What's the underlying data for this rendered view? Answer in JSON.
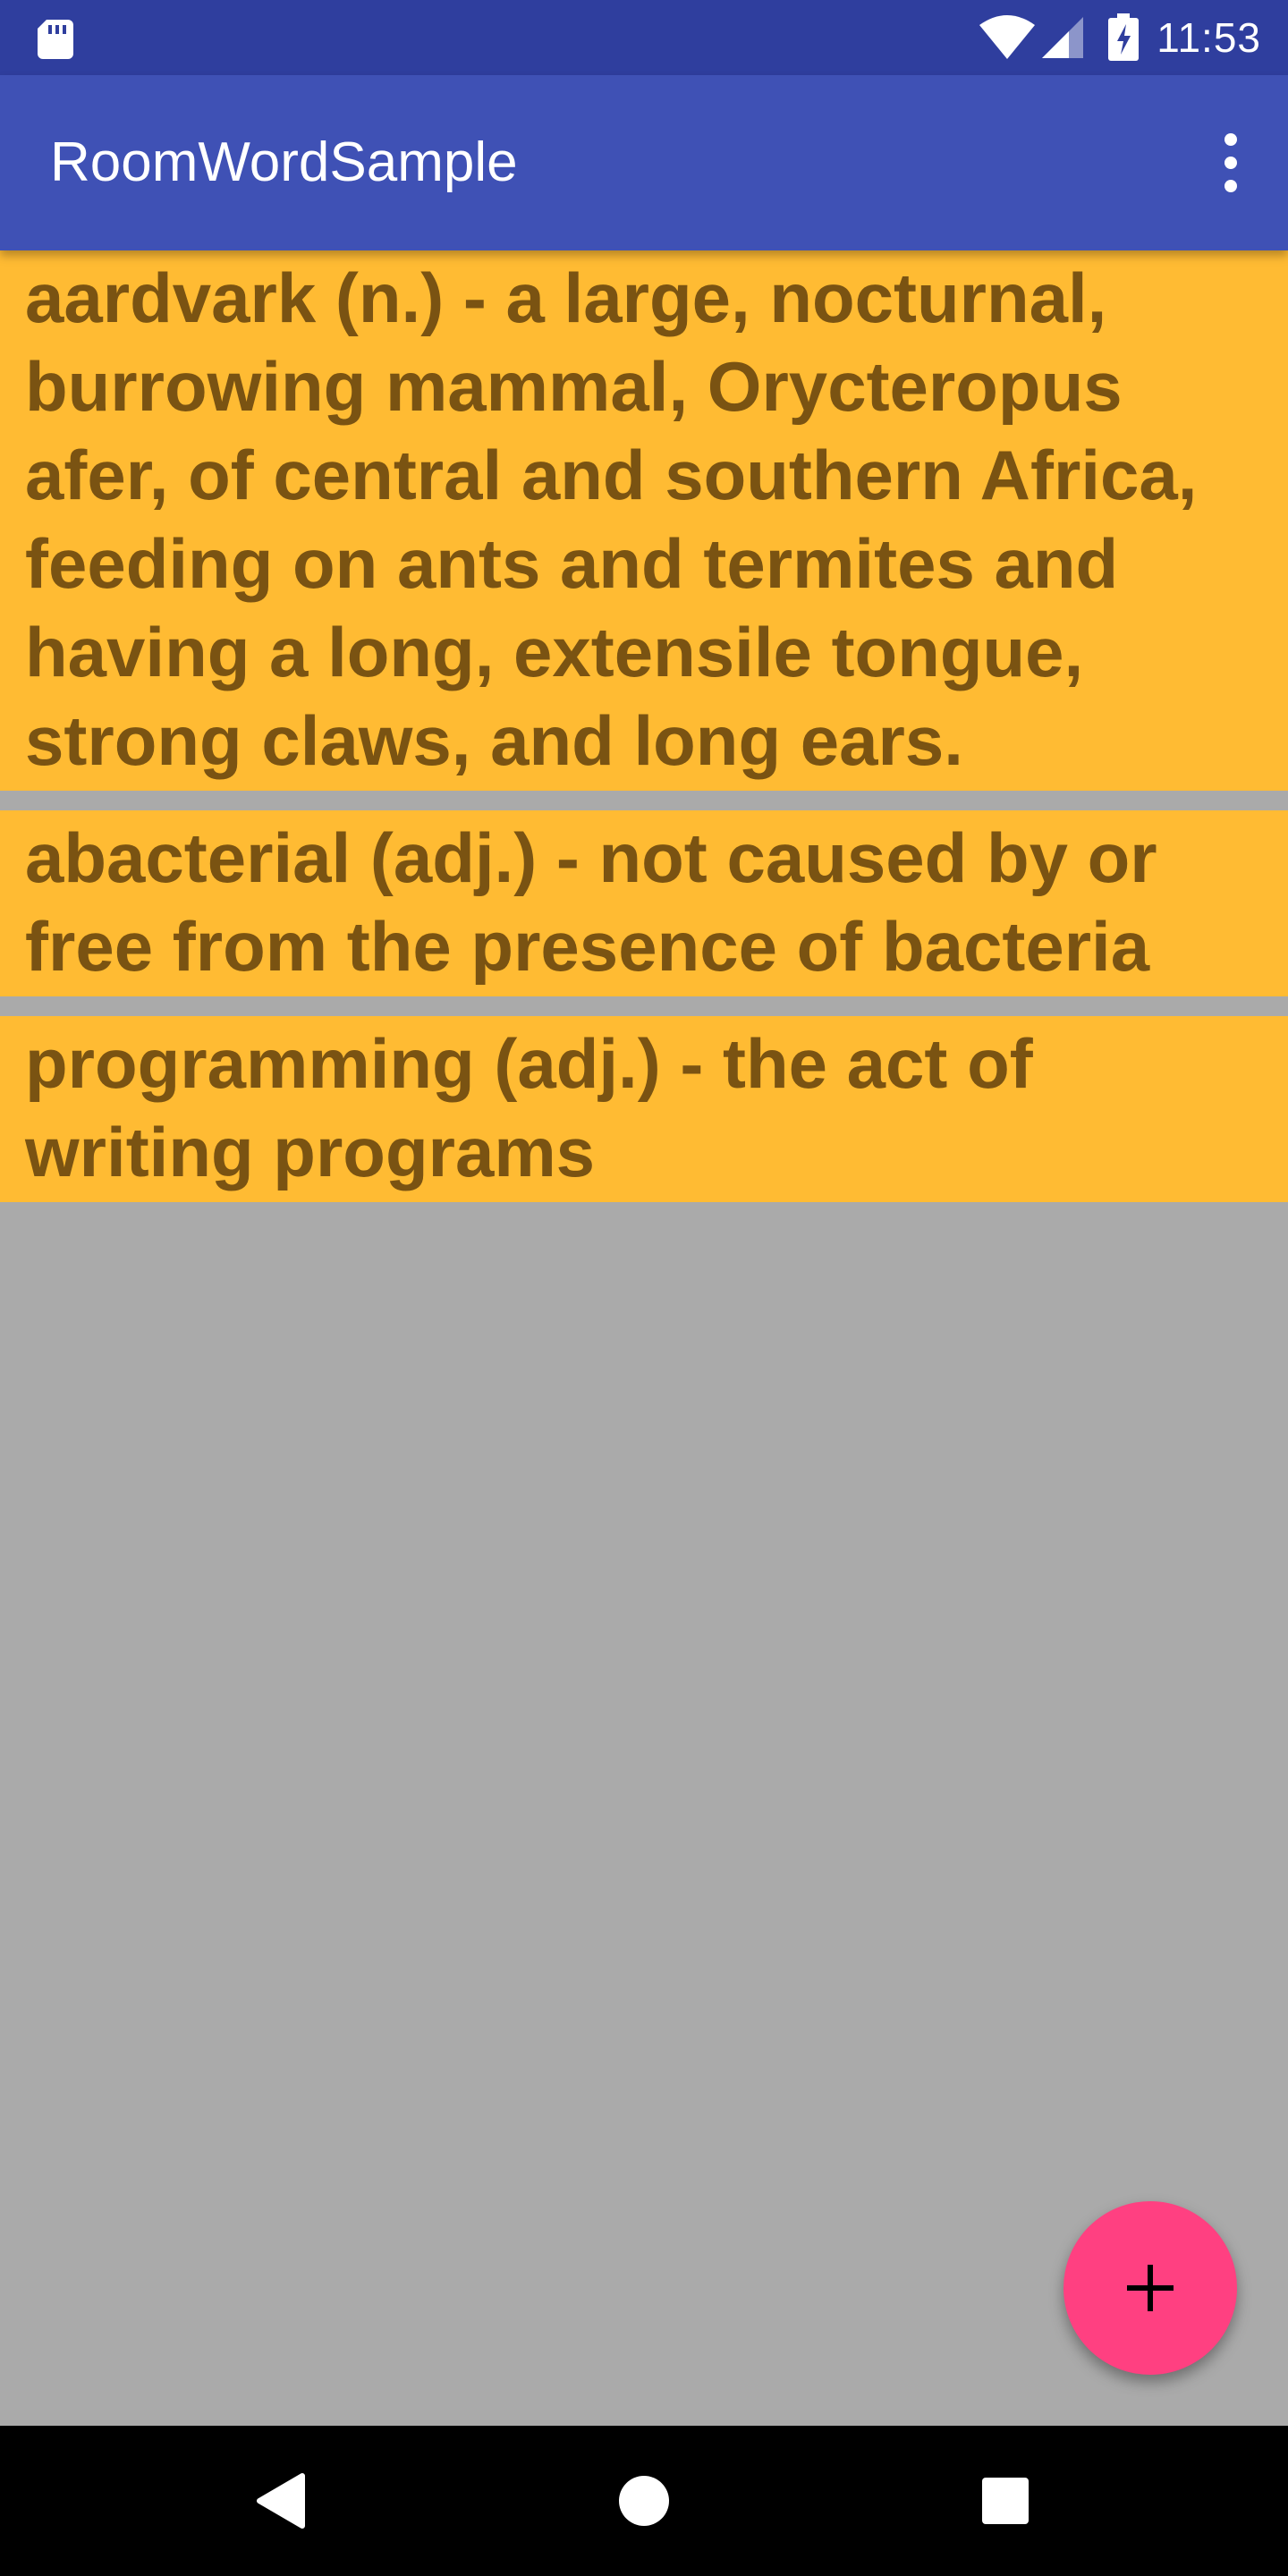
{
  "status_bar": {
    "time": "11:53",
    "icons": [
      "sd-card-icon",
      "wifi-icon",
      "cell-signal-icon",
      "battery-charging-icon"
    ]
  },
  "app_bar": {
    "title": "RoomWordSample",
    "menu_icon": "more-vert-icon"
  },
  "words": [
    {
      "text": "aardvark (n.) - a large, nocturnal, burrowing mammal, Orycteropus afer, of central and southern Africa, feeding on ants and termites and having a long, extensile tongue, strong claws, and long ears."
    },
    {
      "text": "abacterial (adj.) - not caused by or free from the presence of bacteria"
    },
    {
      "text": "programming (adj.) - the act of writing programs"
    }
  ],
  "fab": {
    "icon": "add-icon"
  },
  "nav_bar": {
    "icons": [
      "back-icon",
      "home-icon",
      "recents-icon"
    ]
  },
  "colors": {
    "status_bar": "#2f3e9e",
    "app_bar": "#3f51b5",
    "background": "#aaaaaa",
    "item_background": "#ffbb33",
    "item_text": "#7a5312",
    "fab": "#ff4081"
  }
}
